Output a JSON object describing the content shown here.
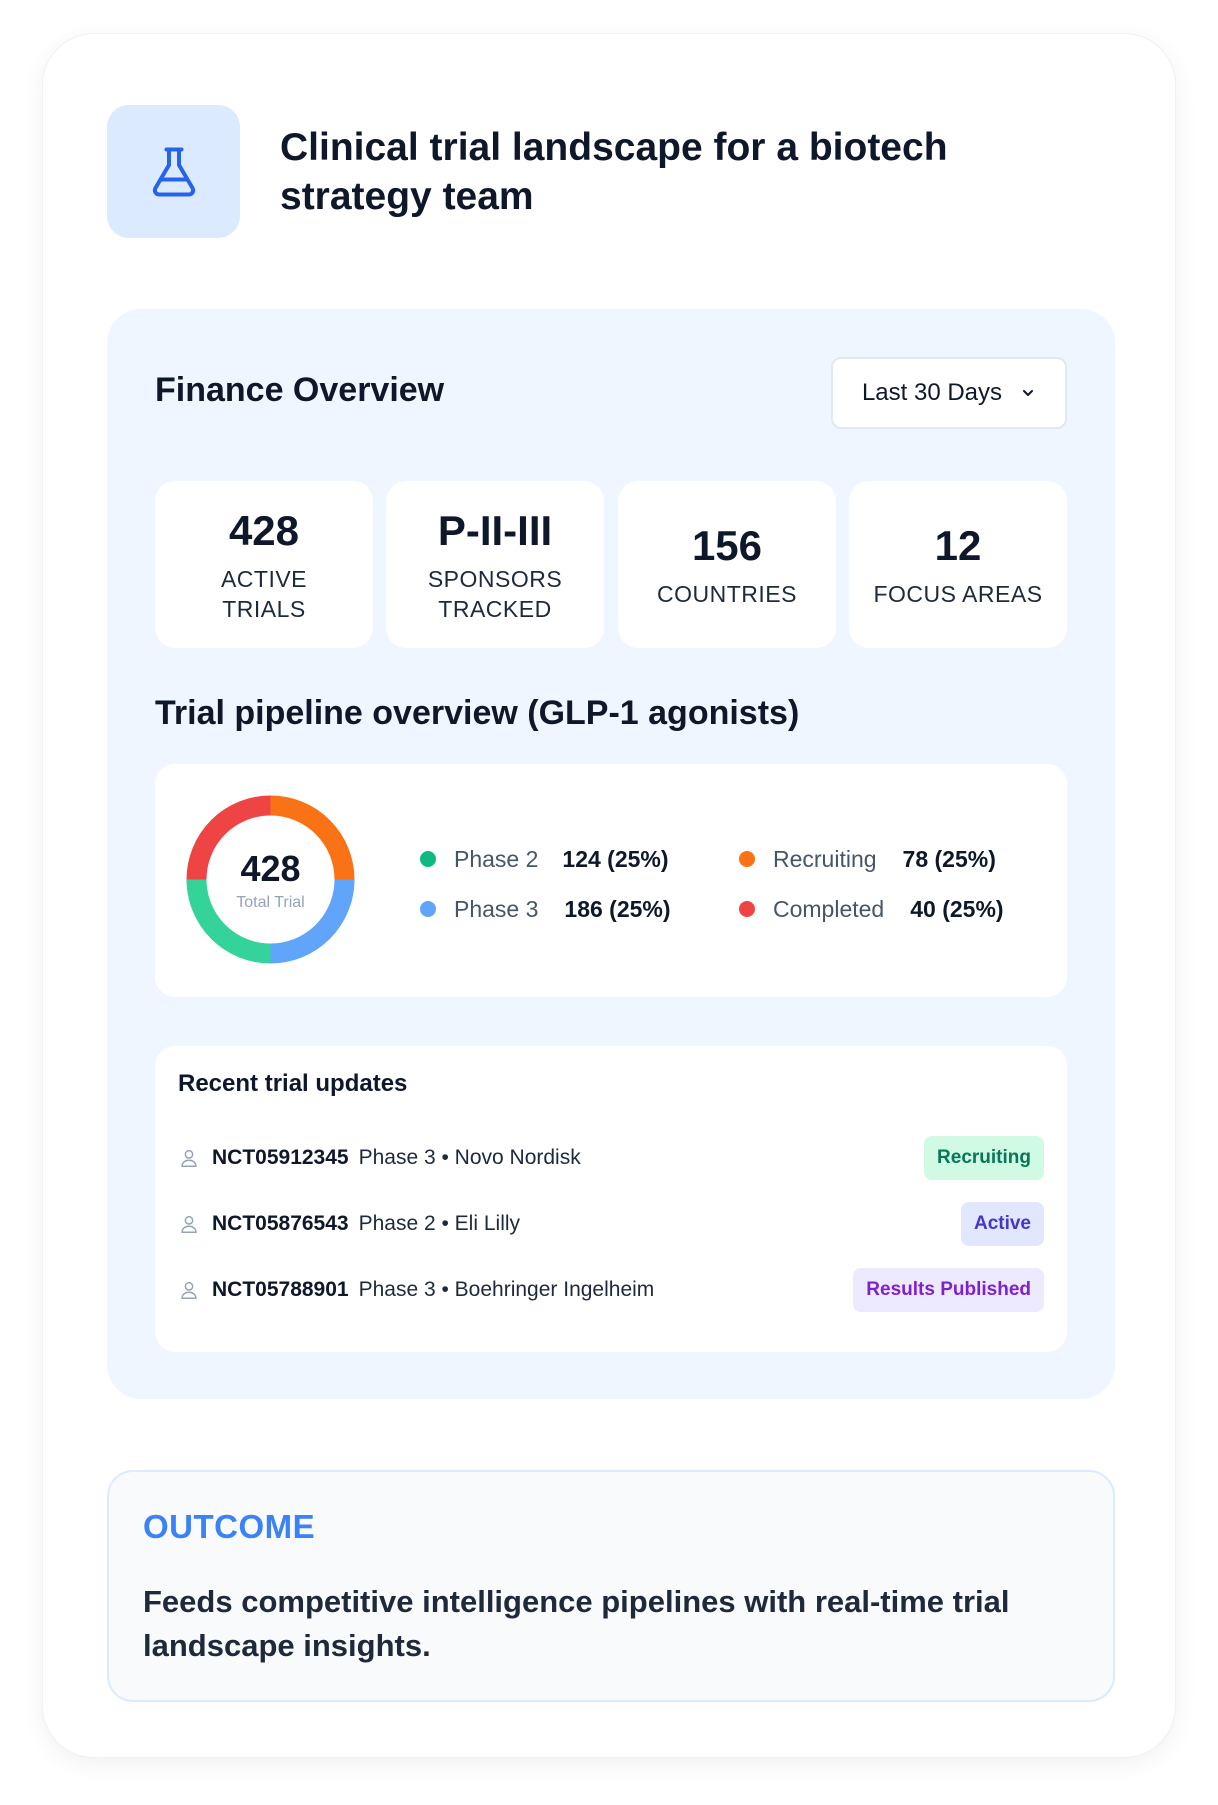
{
  "header": {
    "icon": "flask-icon",
    "title": "Clinical trial landscape for a biotech strategy team"
  },
  "overview": {
    "title": "Finance Overview",
    "range_label": "Last 30 Days",
    "range_icon": "chevron-down-icon"
  },
  "stats": [
    {
      "value": "428",
      "label": "ACTIVE TRIALS"
    },
    {
      "value": "P-II-III",
      "label": "SPONSORS TRACKED"
    },
    {
      "value": "156",
      "label": "COUNTRIES"
    },
    {
      "value": "12",
      "label": "FOCUS AREAS"
    }
  ],
  "pipeline": {
    "title": "Trial pipeline overview (GLP-1 agonists)",
    "total_value": "428",
    "total_label": "Total Trial",
    "legend": [
      {
        "name": "Phase 2",
        "value": "124 (25%)",
        "color": "#10b981"
      },
      {
        "name": "Phase 3",
        "value": "186 (25%)",
        "color": "#60a5fa"
      },
      {
        "name": "Recruiting",
        "value": "78 (25%)",
        "color": "#f97316"
      },
      {
        "name": "Completed",
        "value": "40 (25%)",
        "color": "#ef4444"
      }
    ]
  },
  "chart_data": {
    "type": "pie",
    "categories": [
      "Phase 2",
      "Phase 3",
      "Recruiting",
      "Completed"
    ],
    "values": [
      25,
      25,
      25,
      25
    ],
    "counts": [
      124,
      186,
      78,
      40
    ],
    "colors": [
      "#34d399",
      "#60a5fa",
      "#f97316",
      "#ef4444"
    ],
    "center_value": "428",
    "center_label": "Total Trial"
  },
  "updates": {
    "title": "Recent trial updates",
    "rows": [
      {
        "id": "NCT05912345",
        "detail": "Phase 3 • Novo Nordisk",
        "status": "Recruiting",
        "badge_bg": "#d1fae5",
        "badge_fg": "#047857"
      },
      {
        "id": "NCT05876543",
        "detail": "Phase 2 • Eli Lilly",
        "status": "Active",
        "badge_bg": "#e0e7ff",
        "badge_fg": "#4338ca"
      },
      {
        "id": "NCT05788901",
        "detail": "Phase 3 • Boehringer Ingelheim",
        "status": "Results Published",
        "badge_bg": "#ede9fe",
        "badge_fg": "#7e22ce"
      }
    ],
    "row_icon": "user-icon"
  },
  "outcome": {
    "title": "OUTCOME",
    "text": "Feeds competitive intelligence pipelines with real-time trial landscape insights."
  }
}
